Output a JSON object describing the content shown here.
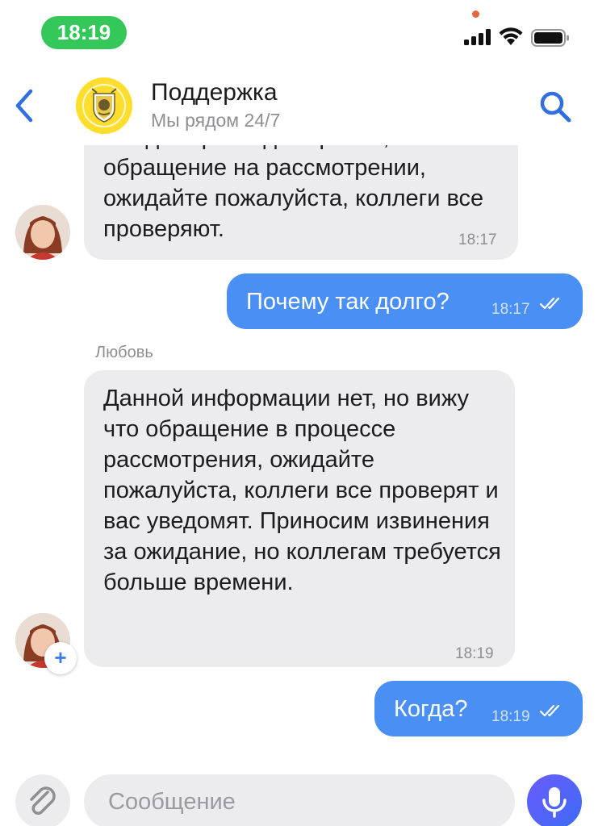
{
  "status_bar": {
    "time": "18:19"
  },
  "header": {
    "title": "Поддержка",
    "subtitle": "Мы рядом 24/7",
    "icons": [
      "chevron-left-icon",
      "bank-logo",
      "search-icon"
    ],
    "accent_color": "#2f6fe0"
  },
  "messages": [
    {
      "direction": "incoming",
      "text": "Владимир Владимирович, ваше обращение на рассмотрении, ожидайте пожалуйста, коллеги все проверяют.",
      "time": "18:17"
    },
    {
      "direction": "outgoing",
      "text": "Почему так долго?",
      "time": "18:17",
      "status": "read"
    },
    {
      "direction": "incoming",
      "sender": "Любовь",
      "text": "Данной информации нет, но вижу что обращение в процессе рассмотрения, ожидайте пожалуйста, коллеги все проверят и вас уведомят. Приносим извинения за ожидание, но коллегам требуется больше времени.",
      "time": "18:19"
    },
    {
      "direction": "outgoing",
      "text": "Когда?",
      "time": "18:19",
      "status": "read"
    }
  ],
  "composer": {
    "placeholder": "Сообщение",
    "value": "",
    "icons": [
      "paperclip-icon",
      "microphone-icon"
    ]
  },
  "colors": {
    "outgoing_bubble": "#4a8ff3",
    "incoming_bubble": "#ececef",
    "time_pill": "#34c759",
    "mic_button": "#5b5ff7"
  }
}
